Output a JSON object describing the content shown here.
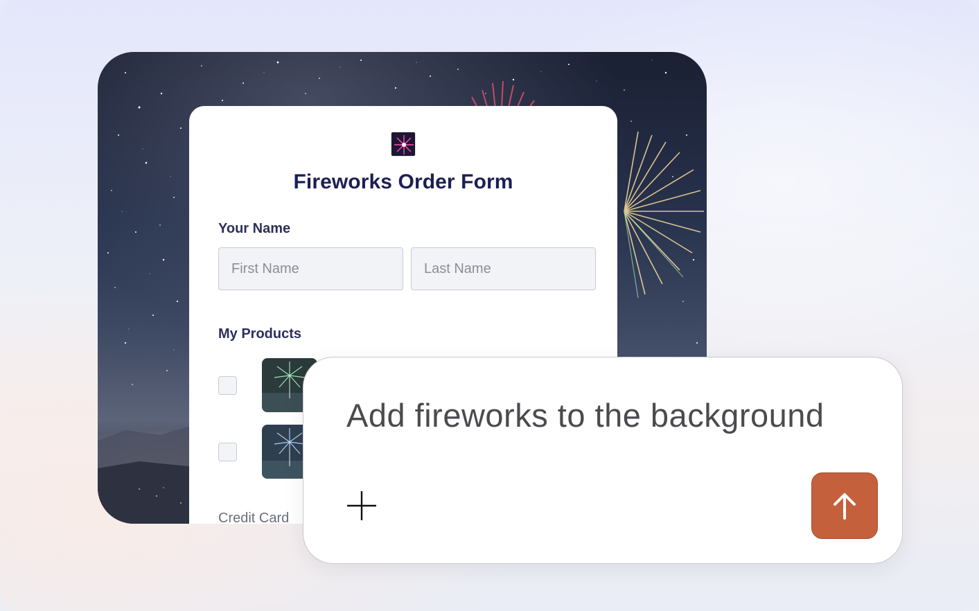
{
  "form": {
    "title": "Fireworks Order Form",
    "logo_icon": "firework-icon",
    "name_label": "Your Name",
    "first_name_placeholder": "First Name",
    "last_name_placeholder": "Last Name",
    "products_label": "My Products",
    "credit_card_label": "Credit Card"
  },
  "prompt": {
    "text": "Add fireworks to the background",
    "add_icon": "plus-icon",
    "send_icon": "arrow-up-icon"
  },
  "colors": {
    "title": "#1c1f52",
    "send_button": "#c5603c"
  }
}
